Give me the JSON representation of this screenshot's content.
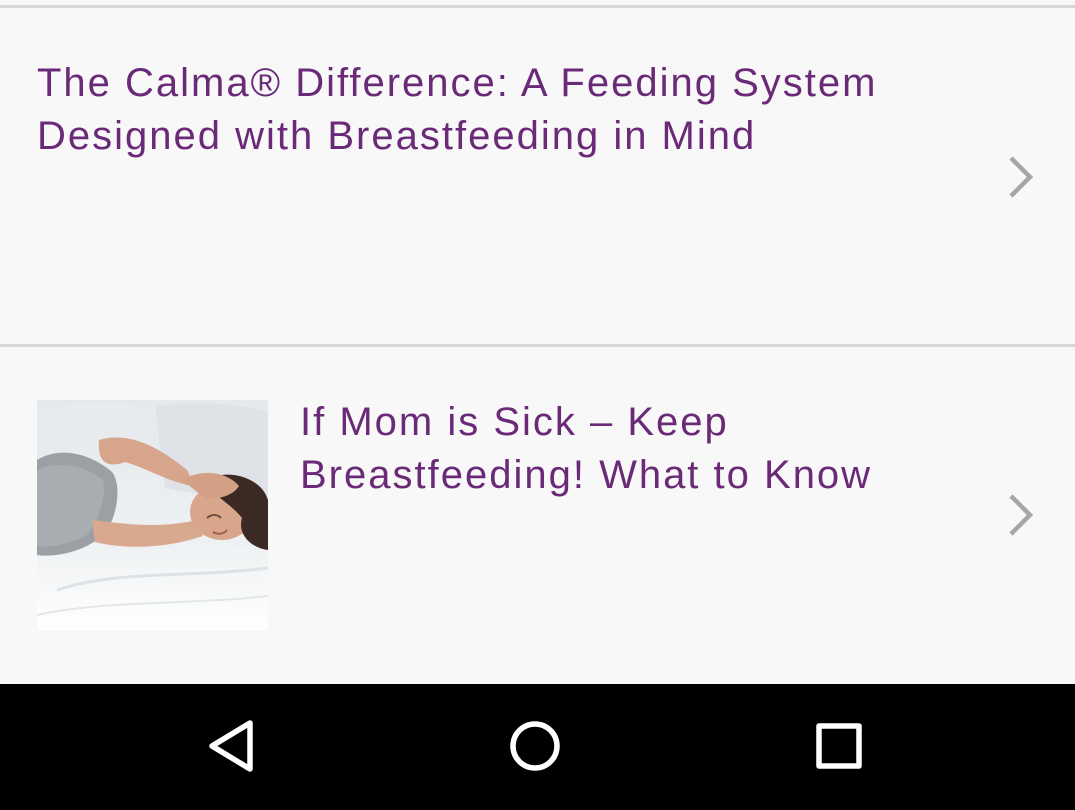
{
  "articles": [
    {
      "title_line1": "The Calma® Difference: A Feeding System",
      "title_line2": "Designed with Breastfeeding in Mind",
      "chevron_icon": "chevron-right-icon"
    },
    {
      "title_line1": "If Mom is Sick – Keep",
      "title_line2": "Breastfeeding! What to Know",
      "thumbnail_icon": "sick-mother-photo",
      "chevron_icon": "chevron-right-icon"
    }
  ],
  "nav_bar": {
    "back_icon": "back-triangle-icon",
    "home_icon": "home-circle-icon",
    "recents_icon": "recents-square-icon"
  },
  "colors": {
    "title": "#6a2a78",
    "background": "#f8f8f8",
    "divider": "#d6d6d6",
    "chevron": "#a6a6a6",
    "nav_bar": "#000000"
  }
}
